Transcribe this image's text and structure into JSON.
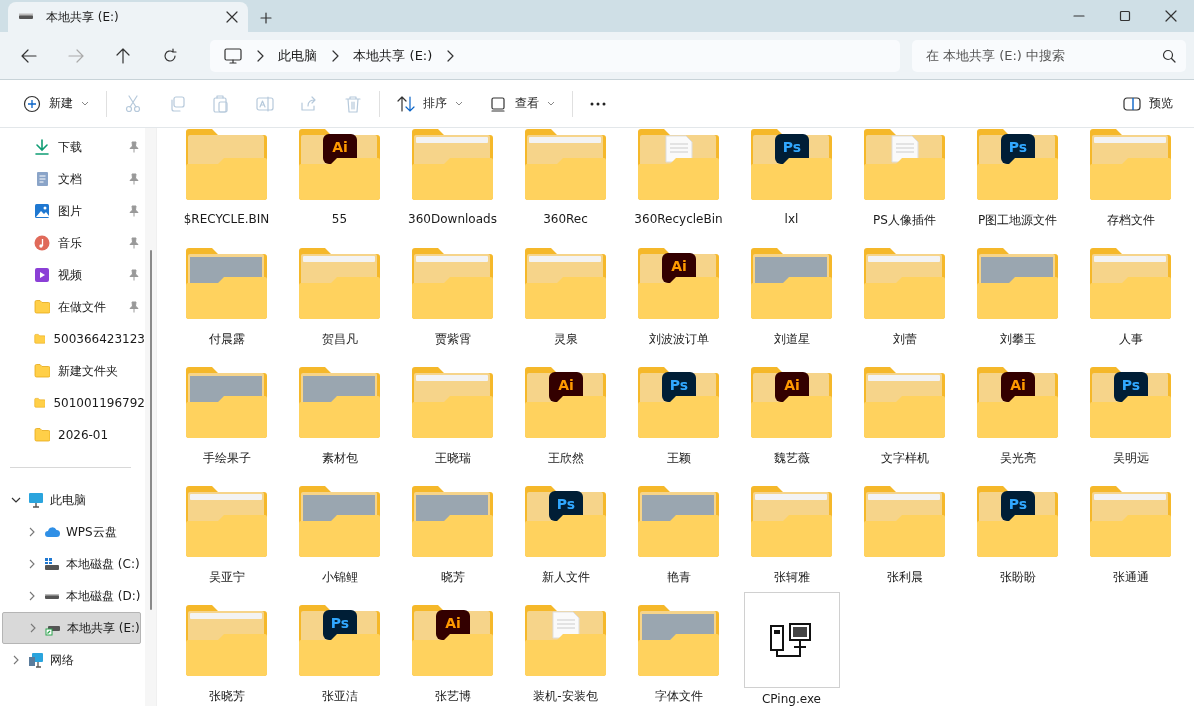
{
  "tabs": [
    {
      "title": "本地共享 (E:)",
      "selected": true
    }
  ],
  "address": {
    "crumbs": [
      "此电脑",
      "本地共享 (E:)"
    ]
  },
  "search": {
    "placeholder": "在 本地共享 (E:) 中搜索"
  },
  "toolbar": {
    "items": [
      {
        "kind": "new",
        "label": "新建",
        "disabled": false
      },
      {
        "kind": "sep"
      },
      {
        "kind": "cut",
        "disabled": true
      },
      {
        "kind": "copy",
        "disabled": true
      },
      {
        "kind": "paste",
        "disabled": true
      },
      {
        "kind": "rename",
        "disabled": true
      },
      {
        "kind": "share",
        "disabled": true
      },
      {
        "kind": "delete",
        "disabled": true
      },
      {
        "kind": "sep"
      },
      {
        "kind": "sort",
        "label": "排序",
        "disabled": false
      },
      {
        "kind": "view",
        "label": "查看",
        "disabled": false
      },
      {
        "kind": "sep"
      },
      {
        "kind": "more",
        "disabled": false
      }
    ],
    "preview": "预览"
  },
  "sidebar": {
    "quick_access": [
      {
        "label": "下载",
        "kind": "download",
        "pinned": true
      },
      {
        "label": "文档",
        "kind": "document",
        "pinned": true
      },
      {
        "label": "图片",
        "kind": "picture",
        "pinned": true
      },
      {
        "label": "音乐",
        "kind": "music",
        "pinned": true
      },
      {
        "label": "视频",
        "kind": "video",
        "pinned": true
      },
      {
        "label": "在做文件",
        "kind": "folder",
        "pinned": true
      },
      {
        "label": "500366423123",
        "kind": "folder",
        "pinned": false
      },
      {
        "label": "新建文件夹",
        "kind": "folder",
        "pinned": false
      },
      {
        "label": "501001196792",
        "kind": "folder",
        "pinned": false
      },
      {
        "label": "2026-01",
        "kind": "folder",
        "pinned": false
      }
    ],
    "tree": [
      {
        "label": "此电脑",
        "kind": "pc",
        "expanded": true,
        "selected": false,
        "children": [
          {
            "label": "WPS云盘",
            "kind": "cloud",
            "expanded": false,
            "selected": false
          },
          {
            "label": "本地磁盘 (C:)",
            "kind": "drive-c",
            "expanded": false,
            "selected": false
          },
          {
            "label": "本地磁盘 (D:)",
            "kind": "drive",
            "expanded": false,
            "selected": false
          },
          {
            "label": "本地共享 (E:)",
            "kind": "drive-share",
            "expanded": false,
            "selected": true
          }
        ]
      },
      {
        "label": "网络",
        "kind": "network",
        "expanded": false,
        "selected": false
      }
    ]
  },
  "files": [
    {
      "name": "$RECYCLE.BIN",
      "kind": "folder",
      "focused": false
    },
    {
      "name": "55",
      "kind": "ai-folder",
      "badge": "Ai",
      "focused": false
    },
    {
      "name": "360Downloads",
      "kind": "sheet-folder",
      "focused": false
    },
    {
      "name": "360Rec",
      "kind": "sheet-folder",
      "focused": false
    },
    {
      "name": "360RecycleBin",
      "kind": "doc-folder",
      "focused": false
    },
    {
      "name": "lxl",
      "kind": "ps-folder",
      "badge": "Ps",
      "focused": false
    },
    {
      "name": "PS人像插件",
      "kind": "doc-folder",
      "focused": false
    },
    {
      "name": "P图工地源文件",
      "kind": "ps-folder",
      "badge": "Ps",
      "focused": false
    },
    {
      "name": "存档文件",
      "kind": "sheet-folder",
      "focused": false
    },
    {
      "name": "付晨露",
      "kind": "photo-folder",
      "focused": false
    },
    {
      "name": "贺昌凡",
      "kind": "sheet-folder",
      "focused": false
    },
    {
      "name": "贾紫霄",
      "kind": "sheet-folder",
      "focused": false
    },
    {
      "name": "灵泉",
      "kind": "sheet-folder",
      "focused": false
    },
    {
      "name": "刘波波订单",
      "kind": "ai-folder",
      "badge": "Ai",
      "focused": false
    },
    {
      "name": "刘道星",
      "kind": "photo-folder",
      "focused": false
    },
    {
      "name": "刘蕾",
      "kind": "sheet-folder",
      "focused": false
    },
    {
      "name": "刘攀玉",
      "kind": "photo-folder",
      "focused": false
    },
    {
      "name": "人事",
      "kind": "sheet-folder",
      "focused": false
    },
    {
      "name": "手绘果子",
      "kind": "photo-folder",
      "focused": false
    },
    {
      "name": "素材包",
      "kind": "photo-folder",
      "focused": false
    },
    {
      "name": "王晓瑞",
      "kind": "sheet-folder",
      "focused": false
    },
    {
      "name": "王欣然",
      "kind": "ai-folder",
      "badge": "Ai",
      "focused": false
    },
    {
      "name": "王颖",
      "kind": "ps-folder",
      "badge": "Ps",
      "focused": false
    },
    {
      "name": "魏艺薇",
      "kind": "ai-folder",
      "badge": "Ai",
      "focused": false
    },
    {
      "name": "文字样机",
      "kind": "sheet-folder",
      "focused": false
    },
    {
      "name": "吴光亮",
      "kind": "ai-folder",
      "badge": "Ai",
      "focused": false
    },
    {
      "name": "吴明远",
      "kind": "ps-folder",
      "badge": "Ps",
      "focused": false
    },
    {
      "name": "吴亚宁",
      "kind": "sheet-folder",
      "focused": false
    },
    {
      "name": "小锦鲤",
      "kind": "photo-folder",
      "focused": false
    },
    {
      "name": "晓芳",
      "kind": "photo-folder",
      "focused": false
    },
    {
      "name": "新人文件",
      "kind": "ps-folder",
      "badge": "Ps",
      "focused": false
    },
    {
      "name": "艳青",
      "kind": "photo-folder",
      "focused": false
    },
    {
      "name": "张轲雅",
      "kind": "sheet-folder",
      "focused": false
    },
    {
      "name": "张利晨",
      "kind": "sheet-folder",
      "focused": false
    },
    {
      "name": "张盼盼",
      "kind": "ps-folder",
      "badge": "Ps",
      "focused": false
    },
    {
      "name": "张通通",
      "kind": "sheet-folder",
      "focused": false
    },
    {
      "name": "张晓芳",
      "kind": "sheet-folder",
      "focused": false
    },
    {
      "name": "张亚洁",
      "kind": "ps-folder",
      "badge": "Ps",
      "focused": false
    },
    {
      "name": "张艺博",
      "kind": "ai-folder",
      "badge": "Ai",
      "focused": false
    },
    {
      "name": "装机-安装包",
      "kind": "doc-folder",
      "focused": false
    },
    {
      "name": "字体文件",
      "kind": "photo-folder",
      "focused": false
    },
    {
      "name": "CPing.exe",
      "kind": "exe",
      "focused": true
    }
  ]
}
